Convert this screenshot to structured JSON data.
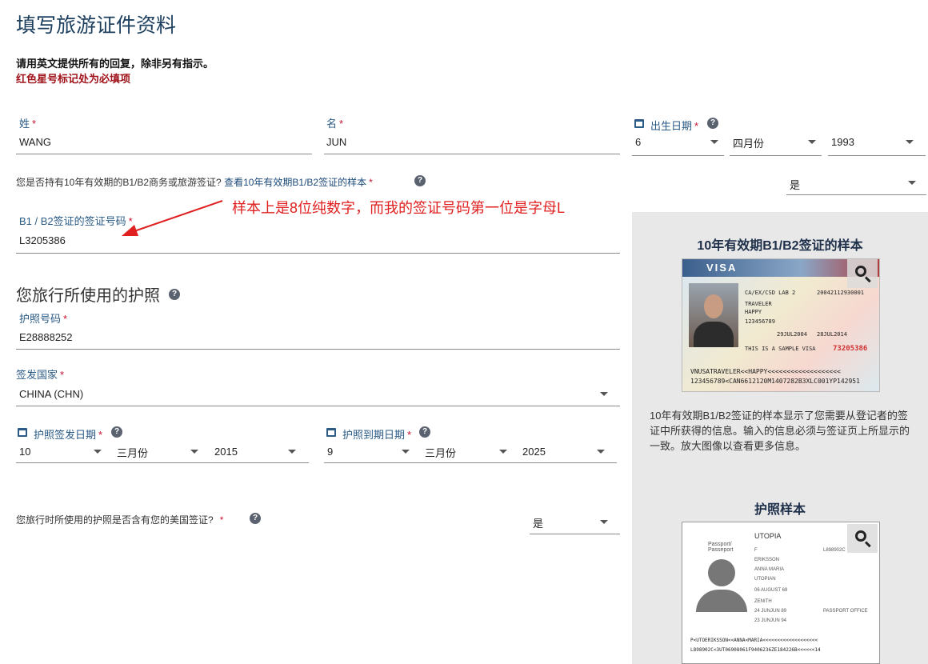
{
  "page": {
    "title": "填写旅游证件资料",
    "instruction": "请用英文提供所有的回复，除非另有指示。",
    "required_note": "红色星号标记处为必填项"
  },
  "name_fields": {
    "surname_label": "姓",
    "surname_value": "WANG",
    "given_label": "名",
    "given_value": "JUN"
  },
  "birth_date": {
    "label": "出生日期",
    "day": "6",
    "month": "四月份",
    "year": "1993"
  },
  "visa_question": {
    "text": "您是否持有10年有效期的B1/B2商务或旅游签证?",
    "link": "查看10年有效期B1/B2签证的样本",
    "answer": "是"
  },
  "visa_number": {
    "label": "B1 / B2签证的签证号码",
    "value": "L3205386"
  },
  "annotation": "样本上是8位纯数字，而我的签证号码第一位是字母L",
  "passport_section": {
    "heading": "您旅行所使用的护照",
    "number_label": "护照号码",
    "number_value": "E28888252",
    "country_label": "签发国家",
    "country_value": "CHINA (CHN)",
    "issue_label": "护照签发日期",
    "issue_day": "10",
    "issue_month": "三月份",
    "issue_year": "2015",
    "expiry_label": "护照到期日期",
    "expiry_day": "9",
    "expiry_month": "三月份",
    "expiry_year": "2025"
  },
  "us_visa_question": {
    "text": "您旅行时所使用的护照是否含有您的美国签证?",
    "answer": "是"
  },
  "sidebar": {
    "visa_sample_title": "10年有效期B1/B2签证的样本",
    "visa_sample_desc": "10年有效期B1/B2签证的样本显示了您需要从登记者的签证中所获得的信息。输入的信息必须与签证页上所显示的一致。放大图像以查看更多信息。",
    "passport_sample_title": "护照样本"
  },
  "visa_image": {
    "word": "VISA",
    "line1": "CA/EX/CSD LAB 2",
    "line2": "TRAVELER",
    "line3": "HAPPY",
    "line4": "123456789",
    "line5": "29JUL2004",
    "line6": "28JUL2014",
    "line7": "THIS IS A SAMPLE VISA",
    "control": "20042112930001",
    "red_number": "73205386",
    "mrz1": "VNUSATRAVELER<<HAPPY<<<<<<<<<<<<<<<<<<<",
    "mrz2": "123456789<CAN6612120M1407282B3XLC001YP142951"
  },
  "passport_image": {
    "country": "UTOPIA",
    "heading": "Passport/ Passeport",
    "surname": "ERIKSSON",
    "given": "ANNA MARIA",
    "nationality": "UTOPIAN",
    "birth": "06 AUGUST 69",
    "number": "L898902C",
    "sex": "F",
    "place": "ZENITH",
    "issue": "24 JUNJUN 89",
    "expiry": "23 JUNJUN 94",
    "authority": "PASSPORT OFFICE",
    "mrz1": "P<UTOERIKSSON<<ANNA<MARIA<<<<<<<<<<<<<<<<<<<",
    "mrz2": "L898902C<3UT06908061F9406236ZE184226B<<<<<<14"
  }
}
